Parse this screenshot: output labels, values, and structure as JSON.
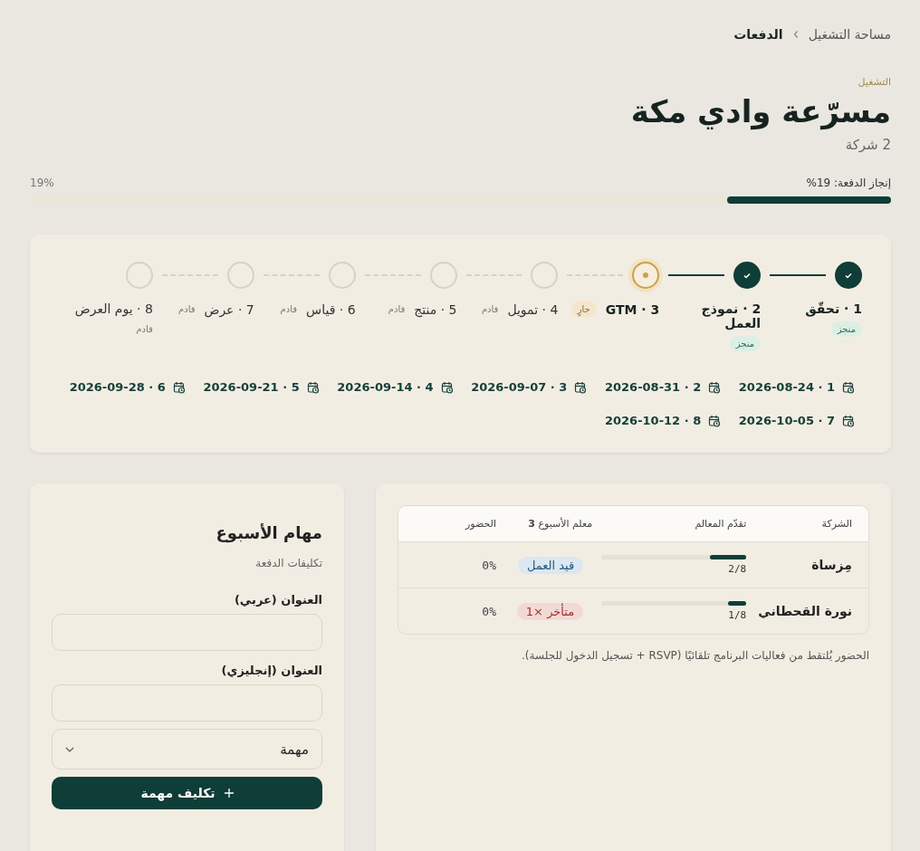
{
  "breadcrumb": [
    {
      "label": "مساحة التشغيل",
      "current": false
    },
    {
      "label": "الدفعات",
      "current": true
    }
  ],
  "eyebrow": "التشغيل",
  "title": "مسرّعة وادي مكة",
  "subtitle": "2 شركة",
  "cohort_progress": {
    "label": "إنجاز الدفعة: 19%",
    "reading": "19%",
    "level": 0.19
  },
  "steps": [
    {
      "label": "1 · تحقّق",
      "kind": "done",
      "status_label": "منجز"
    },
    {
      "label": "2 · نموذج العمل",
      "kind": "done",
      "status_label": "منجز"
    },
    {
      "label": "GTM · 3",
      "kind": "current",
      "status_label": "جارٍ"
    },
    {
      "label": "4 · تمويل",
      "kind": "upcoming",
      "status_label": "قادم"
    },
    {
      "label": "5 · منتج",
      "kind": "upcoming",
      "status_label": "قادم"
    },
    {
      "label": "6 · قياس",
      "kind": "upcoming",
      "status_label": "قادم"
    },
    {
      "label": "7 · عرض",
      "kind": "upcoming",
      "status_label": "قادم"
    },
    {
      "label": "8 · يوم العرض",
      "kind": "upcoming",
      "status_label": "قادم"
    }
  ],
  "week_dates": [
    "1 · 2026-08-24",
    "2 · 2026-08-31",
    "3 · 2026-09-07",
    "4 · 2026-09-14",
    "5 · 2026-09-21",
    "6 · 2026-09-28",
    "7 · 2026-10-05",
    "8 · 2026-10-12"
  ],
  "table": {
    "columns": [
      "الشركة",
      "تقدّم المعالم",
      "معلم الأسبوع **3**",
      "الحضور"
    ],
    "rows": [
      {
        "company": "مِزساة",
        "progress": "2/8",
        "level": 0.25,
        "milestone": "قيد العمل",
        "kind": "in_progress",
        "attendance": "0%"
      },
      {
        "company": "نورة القحطاني",
        "progress": "1/8",
        "level": 0.125,
        "milestone": "متأخر ×1",
        "kind": "late",
        "attendance": "0%"
      }
    ]
  },
  "attendance_note": "الحضور يُلتقط من فعاليات البرنامج تلقائيًا (RSVP + تسجيل الدخول للجلسة).",
  "tasks": {
    "title": "مهام الأسبوع",
    "subtitle": "تكليفات الدفعة",
    "fields": [
      {
        "label": "العنوان (عربي)"
      },
      {
        "label": "العنوان (إنجليزي)"
      }
    ],
    "type_select": "مهمة",
    "submit": "تكليف مهمة"
  }
}
